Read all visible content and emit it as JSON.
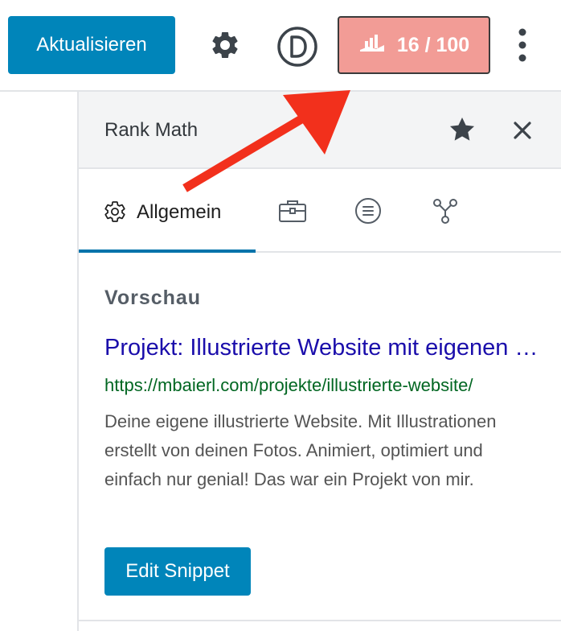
{
  "toolbar": {
    "update_label": "Aktualisieren",
    "score_label": "16 / 100",
    "score_color": "#f29c96",
    "icons": [
      "gear-icon",
      "divi-icon",
      "rank-math-icon",
      "more-vertical-icon"
    ]
  },
  "panel": {
    "title": "Rank Math",
    "icons": [
      "star-icon",
      "close-icon"
    ]
  },
  "tabs": {
    "general_label": "Allgemein",
    "icons": [
      "gear-icon",
      "briefcase-icon",
      "schema-icon",
      "social-share-icon"
    ]
  },
  "preview": {
    "heading": "Vorschau",
    "title": "Projekt: Illustrierte Website mit eigenen Illustrationen",
    "url": "https://mbaierl.com/projekte/illustrierte-website/",
    "description": "Deine eigene illustrierte Website. Mit Illustrationen erstellt von deinen Fotos. Animiert, optimiert und einfach nur genial! Das war ein Projekt von mir."
  },
  "edit_snippet_label": "Edit Snippet",
  "colors": {
    "primary": "#0085ba",
    "link": "#1a0dab",
    "url": "#006621",
    "arrow": "#f2301c"
  }
}
